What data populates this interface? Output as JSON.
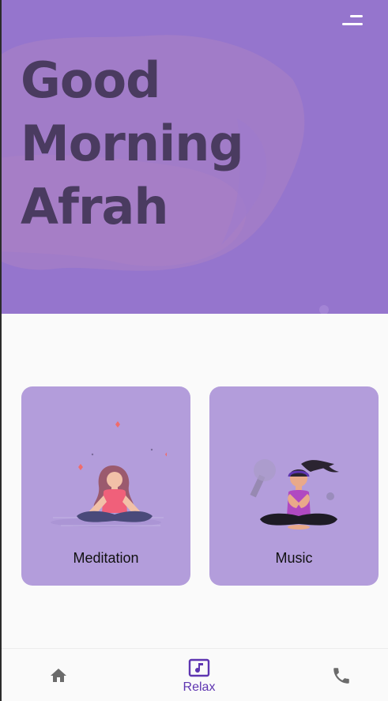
{
  "header": {
    "greeting_line1": "Good Morning",
    "greeting_line2": "Afrah",
    "menu_icon": "menu-icon"
  },
  "cards": [
    {
      "label": "Meditation",
      "icon": "meditation-illustration"
    },
    {
      "label": "Music",
      "icon": "music-illustration"
    }
  ],
  "bottom_nav": {
    "items": [
      {
        "icon": "home-icon",
        "label": ""
      },
      {
        "icon": "music-note-icon",
        "label": "Relax",
        "selected": true
      },
      {
        "icon": "phone-icon",
        "label": ""
      }
    ]
  },
  "colors": {
    "hero_bg": "#9575cd",
    "hero_blob": "#a67fc6",
    "greeting_text": "#4a3b60",
    "card_bg": "#b39ddb",
    "accent": "#5e35b1",
    "nav_icon": "#6b6b6b"
  }
}
